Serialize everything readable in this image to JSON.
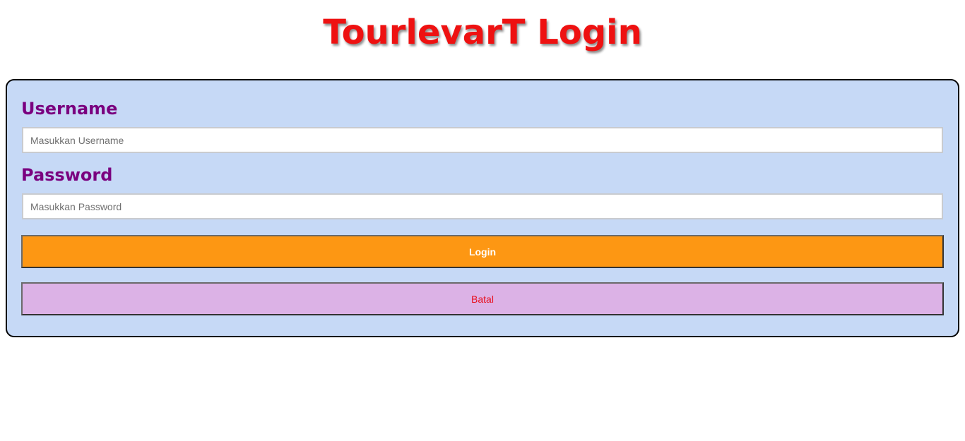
{
  "header": {
    "title": "TourlevarT Login"
  },
  "form": {
    "username_label": "Username",
    "username_placeholder": "Masukkan Username",
    "username_value": "",
    "password_label": "Password",
    "password_placeholder": "Masukkan Password",
    "password_value": "",
    "login_label": "Login",
    "cancel_label": "Batal"
  },
  "colors": {
    "title": "#ee1111",
    "card_background": "#c6d9f6",
    "label": "#7a007f",
    "login_button": "#fd9713",
    "cancel_button": "#dcb2e6",
    "cancel_text": "#e8101e"
  }
}
